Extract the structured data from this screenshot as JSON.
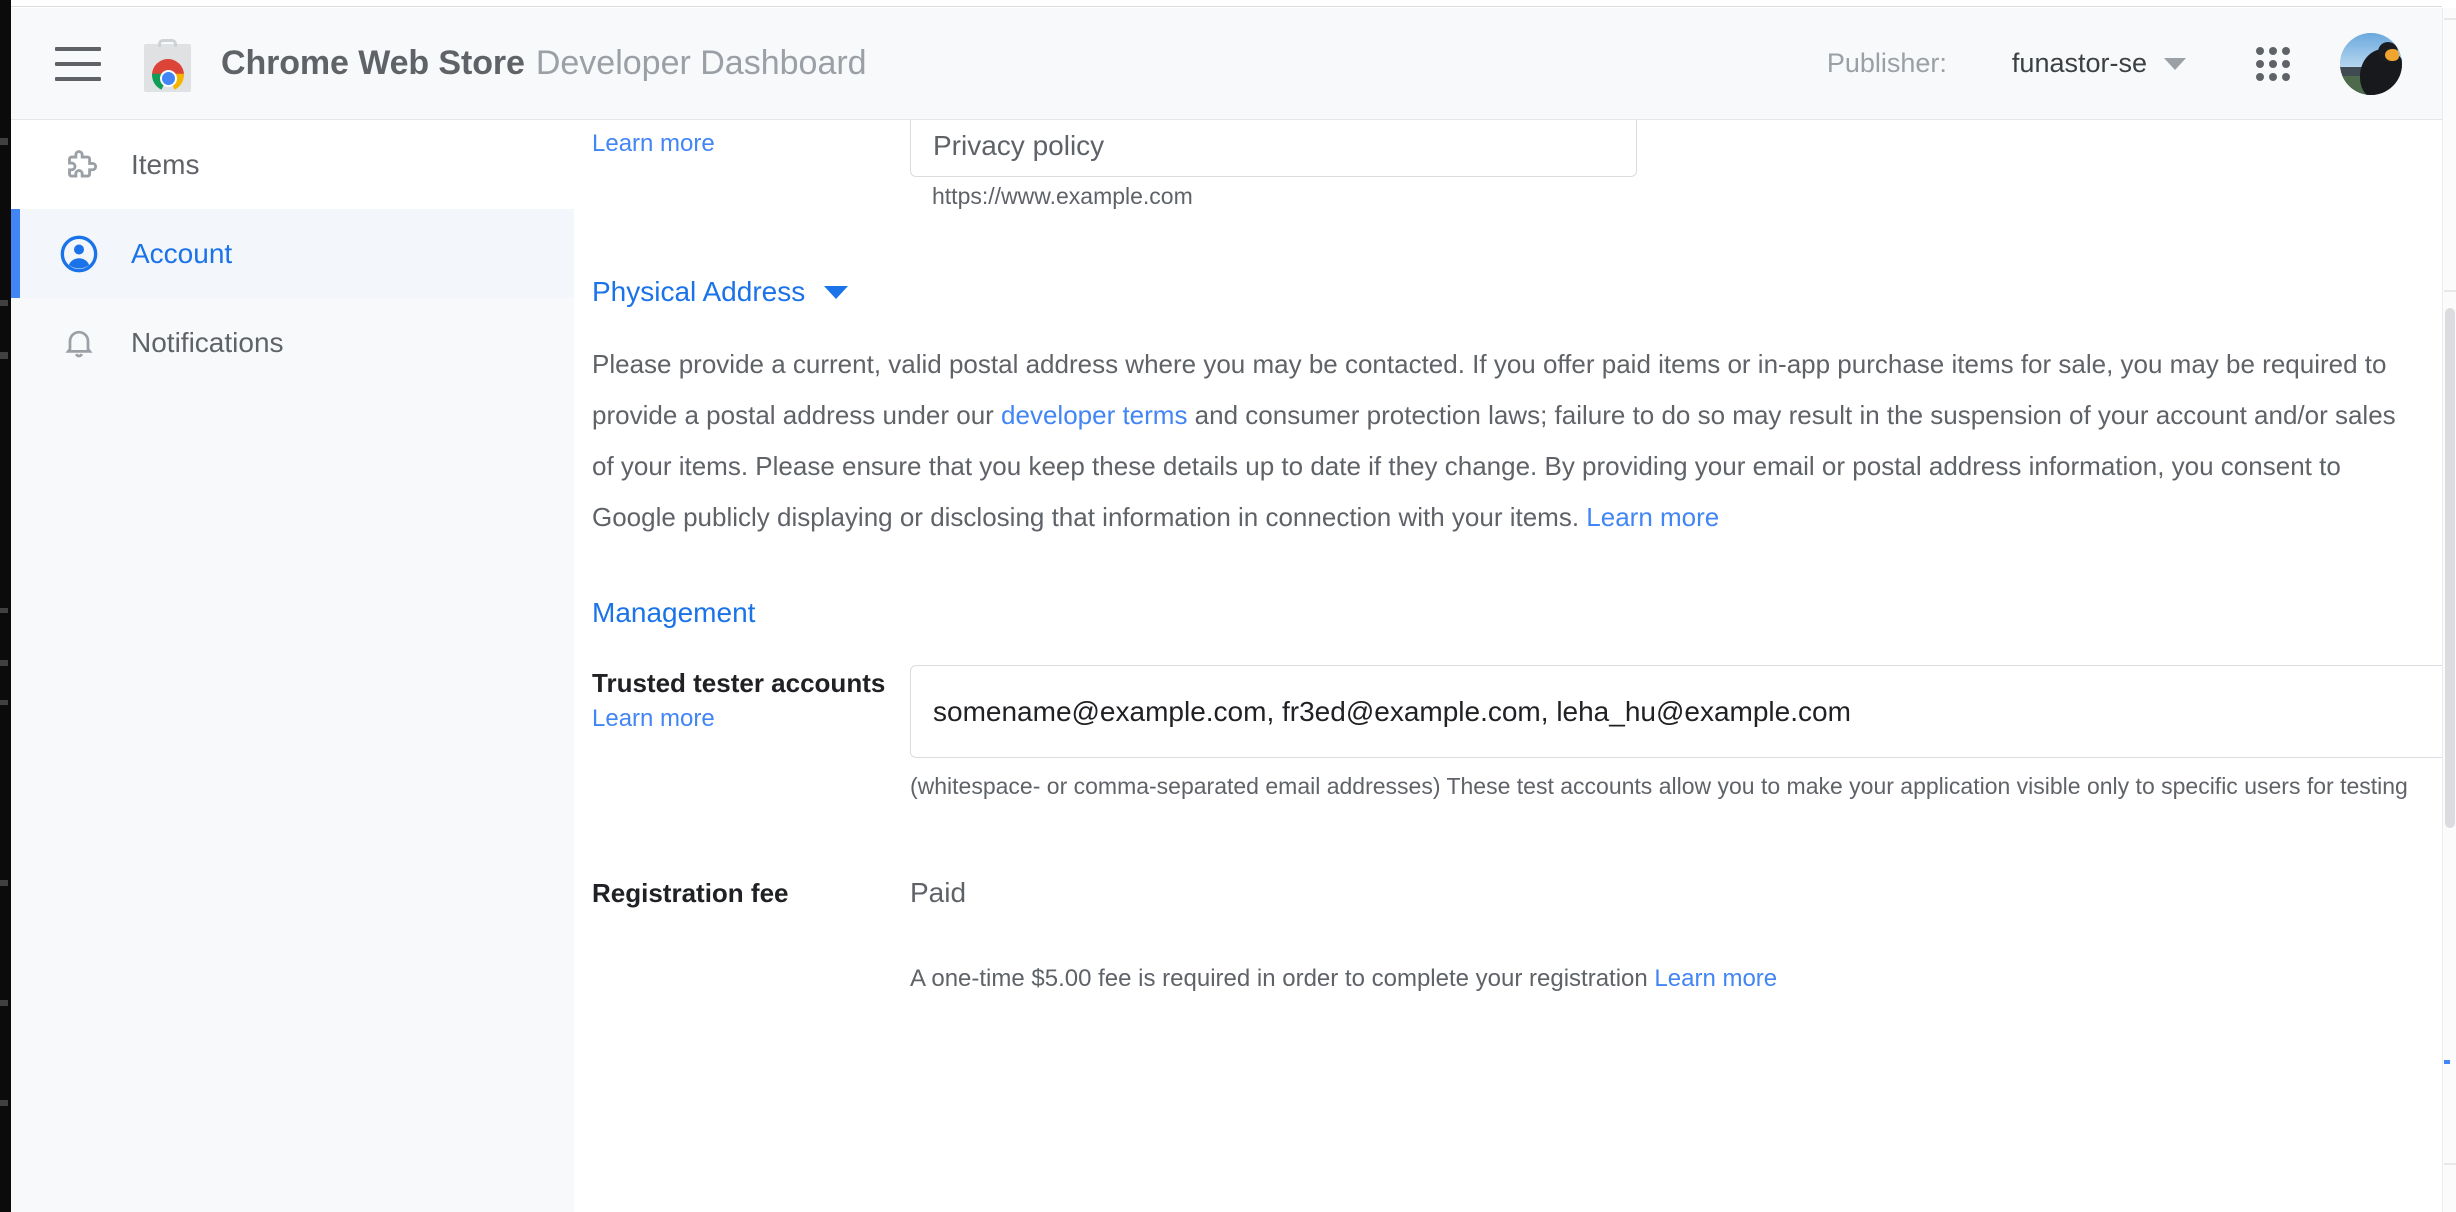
{
  "header": {
    "menu_icon": "hamburger-menu-icon",
    "logo_icon": "chrome-web-store-logo",
    "title_strong": "Chrome Web Store",
    "title_light": "Developer Dashboard",
    "publisher_label": "Publisher:",
    "publisher_name": "funastor-se",
    "publisher_caret_icon": "chevron-down-icon",
    "apps_icon": "google-apps-grid-icon",
    "avatar_icon": "user-avatar"
  },
  "sidebar": {
    "items": [
      {
        "label": "Items",
        "icon": "puzzle-piece-icon",
        "state": "default"
      },
      {
        "label": "Account",
        "icon": "account-circle-icon",
        "state": "active"
      },
      {
        "label": "Notifications",
        "icon": "bell-icon",
        "state": "default"
      }
    ]
  },
  "main": {
    "top_partial": {
      "learn_more": "Learn more",
      "privacy_policy_label": "Privacy policy",
      "privacy_policy_value": "",
      "privacy_policy_hint": "https://www.example.com"
    },
    "physical_address": {
      "heading": "Physical Address",
      "caret_icon": "chevron-down-icon",
      "paragraph_part_1": "Please provide a current, valid postal address where you may be contacted. If you offer paid items or in-app purchase items for sale, you may be required to provide a postal address under our ",
      "developer_terms_link": "developer terms",
      "paragraph_part_2": " and consumer protection laws; failure to do so may result in the suspension of your account and/or sales of your items. Please ensure that you keep these details up to date if they change. By providing your email or postal address information, you consent to Google publicly displaying or disclosing that information in connection with your items. ",
      "learn_more_link": "Learn more"
    },
    "management": {
      "heading": "Management",
      "trusted_tester": {
        "label": "Trusted tester accounts",
        "learn_more": "Learn more",
        "value": "somename@example.com, fr3ed@example.com, leha_hu@example.com",
        "placeholder": "Trusted tester accounts",
        "hint": "(whitespace- or comma-separated email addresses) These test accounts allow you to make your application visible only to specific users for testing"
      },
      "registration_fee": {
        "label": "Registration fee",
        "value": "Paid",
        "hint_text": "A one-time $5.00 fee is required in order to complete your registration ",
        "hint_link": "Learn more"
      }
    }
  },
  "colors": {
    "accent_blue": "#1a73e8",
    "link_blue": "#4285f4",
    "text_primary": "#202124",
    "text_secondary": "#5f6368",
    "header_bg": "#f8f9fa",
    "sidebar_bg": "#f8f9fa"
  }
}
